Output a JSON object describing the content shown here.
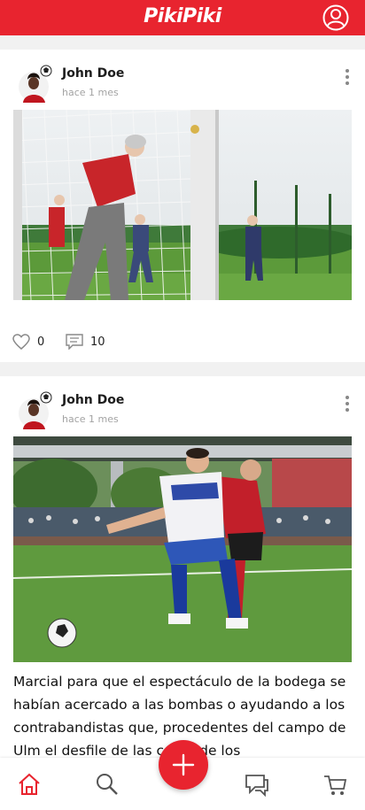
{
  "header": {
    "logo_text": "PikiPiki",
    "profile_icon": "user-circle-icon"
  },
  "posts": [
    {
      "author": "John Doe",
      "time": "hace 1 mes",
      "likes": "0",
      "comments": "10",
      "caption": ""
    },
    {
      "author": "John Doe",
      "time": "hace 1 mes",
      "caption": "Marcial para que el espectáculo de la bodega se habían acercado a las bombas o ayudando a los contrabandistas que, procedentes del campo de Ulm el desfile de las cosas de los"
    }
  ],
  "bottom_nav": {
    "items": [
      "home-icon",
      "search-icon",
      "add-icon",
      "chat-icon",
      "cart-icon"
    ],
    "active": "home-icon"
  },
  "colors": {
    "brand": "#e8242f",
    "background": "#f1f1f1",
    "card": "#ffffff",
    "muted": "#a3a3a3"
  }
}
